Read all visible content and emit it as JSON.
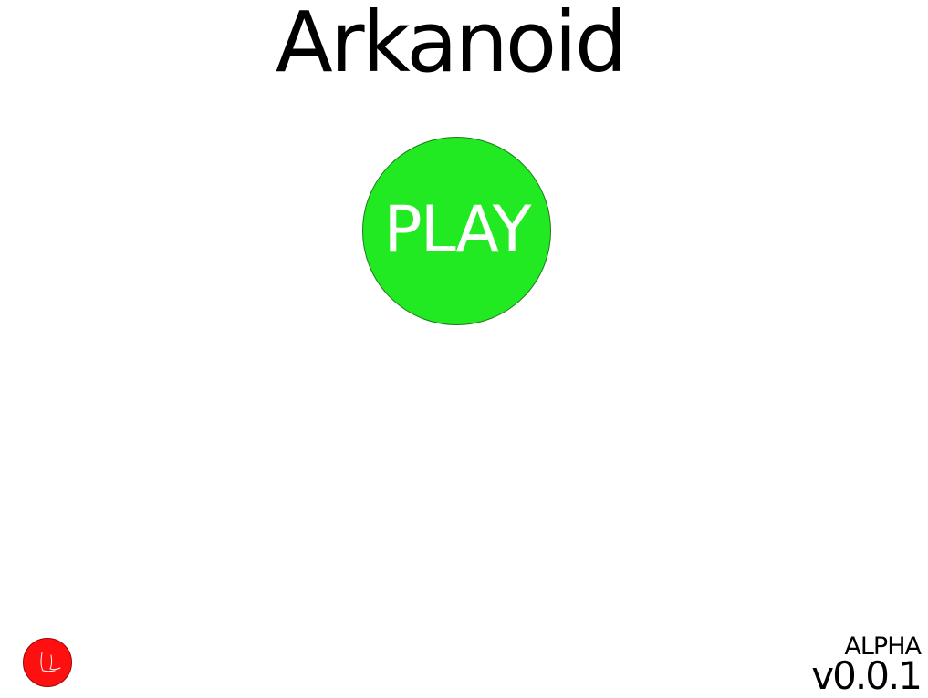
{
  "title": "Arkanoid",
  "play_button": {
    "label": "PLAY",
    "color": "#22ea22"
  },
  "logo": {
    "icon": "red-circle-logo",
    "color": "#ff0000"
  },
  "version_info": {
    "stage": "ALPHA",
    "version": "v0.0.1"
  }
}
